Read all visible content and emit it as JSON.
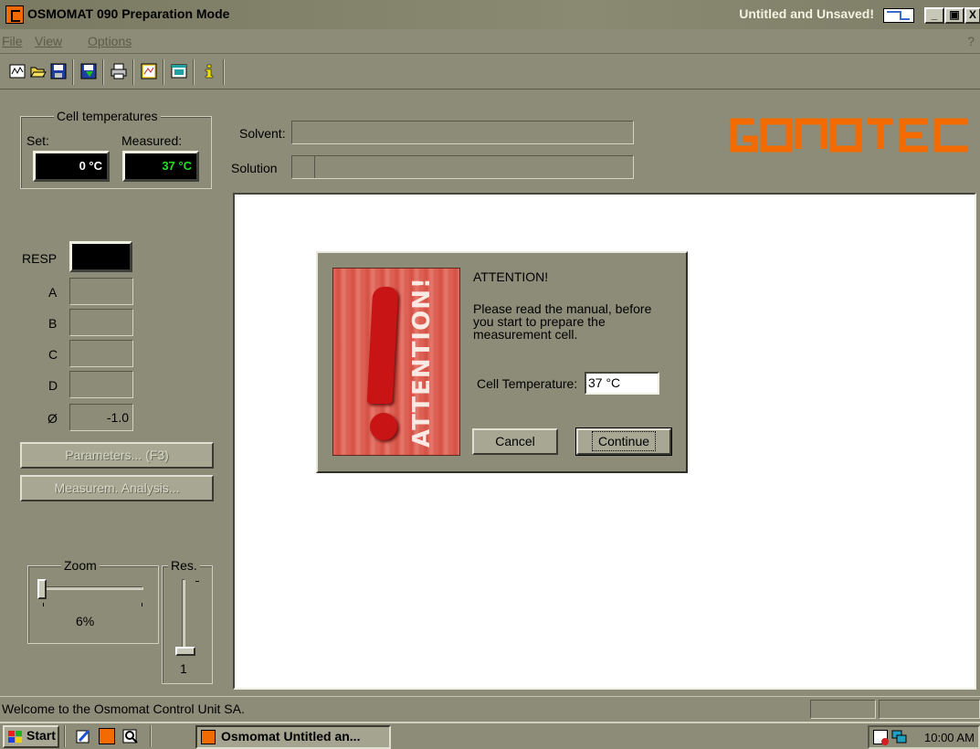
{
  "window": {
    "title": "OSMOMAT 090 Preparation Mode",
    "saved_state": "Untitled and Unsaved!",
    "minimize": "_",
    "maximize": "▣",
    "close": "X"
  },
  "menu": {
    "file": "File",
    "view": "View",
    "options": "Options",
    "help": "?"
  },
  "toolbar": {
    "icons": [
      "chart-icon",
      "open-folder-icon",
      "save-icon",
      "export-icon",
      "print-icon",
      "graph-icon",
      "window-icon",
      "info-icon"
    ]
  },
  "cell_temperatures": {
    "group_label": "Cell temperatures",
    "set_label": "Set:",
    "measured_label": "Measured:",
    "set_value": "0 °C",
    "measured_value": "37 °C",
    "measured_color": "#20e020"
  },
  "solvent_label": "Solvent:",
  "solution_label": "Solution",
  "logo": "gonotec",
  "logo_color": "#f26a00",
  "readings": {
    "resp_label": "RESP",
    "a_label": "A",
    "b_label": "B",
    "c_label": "C",
    "d_label": "D",
    "avg_label": "Ø",
    "avg_value": "-1.0"
  },
  "buttons": {
    "parameters": "Parameters... (F3)",
    "analysis": "Measurem. Analysis..."
  },
  "zoom": {
    "label": "Zoom",
    "value": "6%",
    "fraction": 0.0
  },
  "res": {
    "label": "Res.",
    "value": "1",
    "fraction": 0.0
  },
  "dialog": {
    "heading": "ATTENTION!",
    "message": "Please read the manual, before you start to prepare the measurement cell.",
    "image_text": "ATTENTION!",
    "temp_label": "Cell Temperature:",
    "temp_value": "37 °C",
    "cancel": "Cancel",
    "continue": "Continue"
  },
  "status": {
    "message": "Welcome to the Osmomat Control Unit SA."
  },
  "taskbar": {
    "start": "Start",
    "task": "Osmomat Untitled an...",
    "clock": "10:00 AM"
  }
}
